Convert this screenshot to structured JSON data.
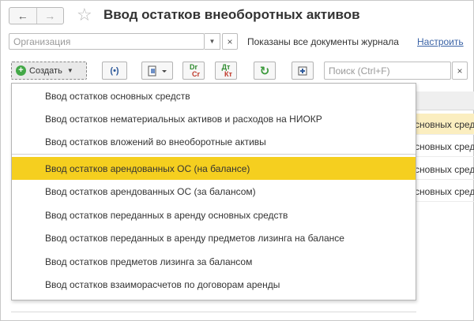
{
  "window": {
    "title": "Ввод остатков внеоборотных активов"
  },
  "filter": {
    "organization_placeholder": "Организация",
    "shown_text": "Показаны все документы журнала",
    "setup_link": "Настроить"
  },
  "toolbar": {
    "create_label": "Создать",
    "dt_label": "Дт",
    "kt_label": "Кт",
    "dr_label": "Dr",
    "cr_label": "Cr",
    "search_placeholder": "Поиск (Ctrl+F)"
  },
  "table": {
    "rows": [
      {
        "text": "сновных сред"
      },
      {
        "text": "сновных сред"
      },
      {
        "text": "сновных сред"
      },
      {
        "text": "сновных сред"
      }
    ]
  },
  "menu": {
    "items": [
      {
        "label": "Ввод остатков основных средств"
      },
      {
        "label": "Ввод остатков нематериальных активов и расходов на НИОКР"
      },
      {
        "label": "Ввод остатков вложений во внеоборотные активы"
      },
      {
        "label": "Ввод остатков арендованных ОС (на балансе)"
      },
      {
        "label": "Ввод остатков арендованных ОС (за балансом)"
      },
      {
        "label": "Ввод остатков переданных в аренду основных средств"
      },
      {
        "label": "Ввод остатков переданных в аренду предметов лизинга на балансе"
      },
      {
        "label": "Ввод остатков предметов лизинга за балансом"
      },
      {
        "label": "Ввод остатков взаиморасчетов по договорам аренды"
      }
    ],
    "highlighted_index": 3
  },
  "colors": {
    "highlight": "#f5cf1f",
    "accent_green": "#43a847",
    "link_blue": "#3a63a6",
    "dr_green": "#2e8b2e",
    "cr_red": "#c0392b"
  }
}
